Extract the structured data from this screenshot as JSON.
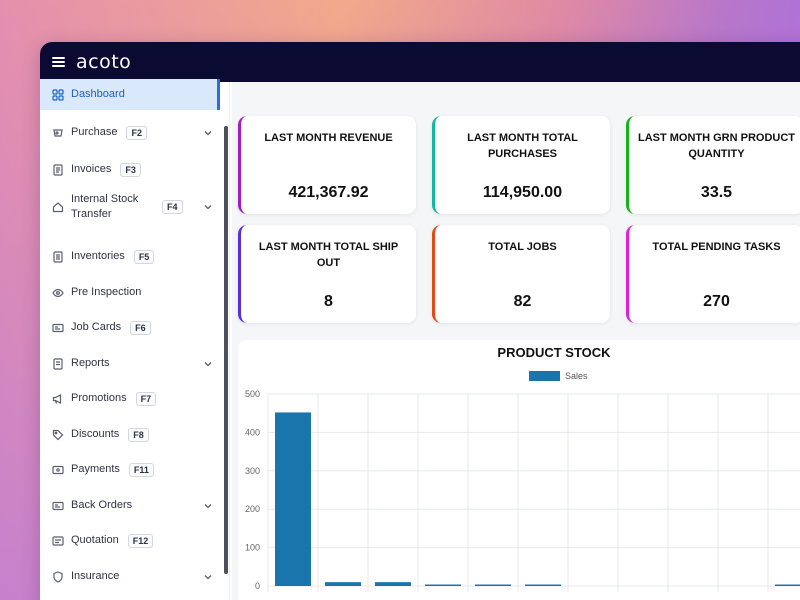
{
  "app": {
    "logo": "acoto"
  },
  "sidebar": {
    "items": [
      {
        "label": "Dashboard",
        "shortcut": "",
        "icon": "grid-icon",
        "expandable": false,
        "active": true
      },
      {
        "label": "Purchase",
        "shortcut": "F2",
        "icon": "purchase-icon",
        "expandable": true
      },
      {
        "label": "Invoices",
        "shortcut": "F3",
        "icon": "invoice-icon",
        "expandable": false
      },
      {
        "label": "Internal Stock Transfer",
        "shortcut": "F4",
        "icon": "home-icon",
        "expandable": true
      },
      {
        "label": "Inventories",
        "shortcut": "F5",
        "icon": "inventory-icon",
        "expandable": false
      },
      {
        "label": "Pre Inspection",
        "shortcut": "",
        "icon": "eye-icon",
        "expandable": false
      },
      {
        "label": "Job Cards",
        "shortcut": "F6",
        "icon": "card-icon",
        "expandable": false
      },
      {
        "label": "Reports",
        "shortcut": "",
        "icon": "report-icon",
        "expandable": true
      },
      {
        "label": "Promotions",
        "shortcut": "F7",
        "icon": "megaphone-icon",
        "expandable": false
      },
      {
        "label": "Discounts",
        "shortcut": "F8",
        "icon": "tag-icon",
        "expandable": false
      },
      {
        "label": "Payments",
        "shortcut": "F11",
        "icon": "wallet-icon",
        "expandable": false
      },
      {
        "label": "Back Orders",
        "shortcut": "",
        "icon": "card-icon",
        "expandable": true
      },
      {
        "label": "Quotation",
        "shortcut": "F12",
        "icon": "quote-icon",
        "expandable": false
      },
      {
        "label": "Insurance",
        "shortcut": "",
        "icon": "shield-icon",
        "expandable": true
      }
    ]
  },
  "cards": [
    {
      "title": "LAST MONTH REVENUE",
      "value": "421,367.92",
      "accent": "#a020c8"
    },
    {
      "title": "LAST MONTH TOTAL PURCHASES",
      "value": "114,950.00",
      "accent": "#14b8a0"
    },
    {
      "title": "LAST MONTH GRN PRODUCT QUANTITY",
      "value": "33.5",
      "accent": "#16b316"
    },
    {
      "title": "LAST MONTH TOTAL SHIP OUT",
      "value": "8",
      "accent": "#5a2fe0"
    },
    {
      "title": "TOTAL JOBS",
      "value": "82",
      "accent": "#e24a16"
    },
    {
      "title": "TOTAL PENDING TASKS",
      "value": "270",
      "accent": "#e020d8"
    }
  ],
  "chart_data": {
    "type": "bar",
    "title": "PRODUCT STOCK",
    "series": [
      {
        "name": "Sales",
        "color": "#1b75ad",
        "values": [
          452,
          10,
          10,
          3,
          3,
          1,
          0,
          0,
          0,
          0,
          1
        ]
      }
    ],
    "yticks": [
      0,
      100,
      200,
      300,
      400,
      500
    ],
    "ylim": [
      0,
      500
    ],
    "grid": true,
    "legend": "top"
  }
}
